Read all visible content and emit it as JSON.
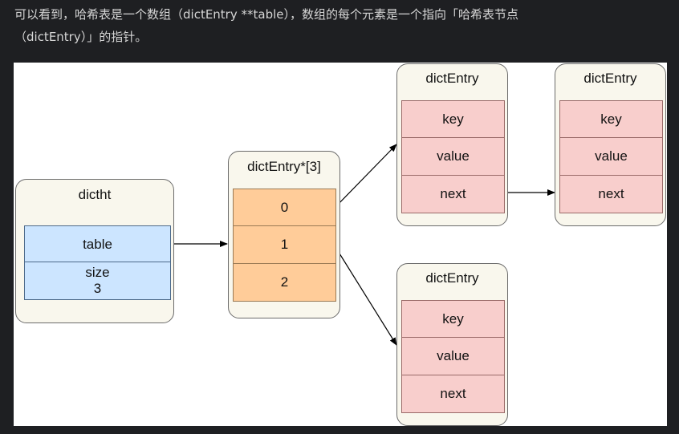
{
  "caption": {
    "line1": "可以看到，哈希表是一个数组（dictEntry **table），数组的每个元素是一个指向「哈希表节点",
    "line2": "（dictEntry）」的指针。"
  },
  "diagram": {
    "dictht": {
      "title": "dictht",
      "table_label": "table",
      "size_label": "size",
      "size_value": "3"
    },
    "array": {
      "title": "dictEntry*[3]",
      "slots": [
        "0",
        "1",
        "2"
      ]
    },
    "entry_a": {
      "title": "dictEntry",
      "fields": [
        "key",
        "value",
        "next"
      ]
    },
    "entry_b": {
      "title": "dictEntry",
      "fields": [
        "key",
        "value",
        "next"
      ]
    },
    "entry_c": {
      "title": "dictEntry",
      "fields": [
        "key",
        "value",
        "next"
      ]
    },
    "colors": {
      "node_bg": "#f9f7ed",
      "table_cell": "#cce5ff",
      "array_cell": "#ffcc99",
      "entry_cell": "#f8cecc"
    }
  }
}
